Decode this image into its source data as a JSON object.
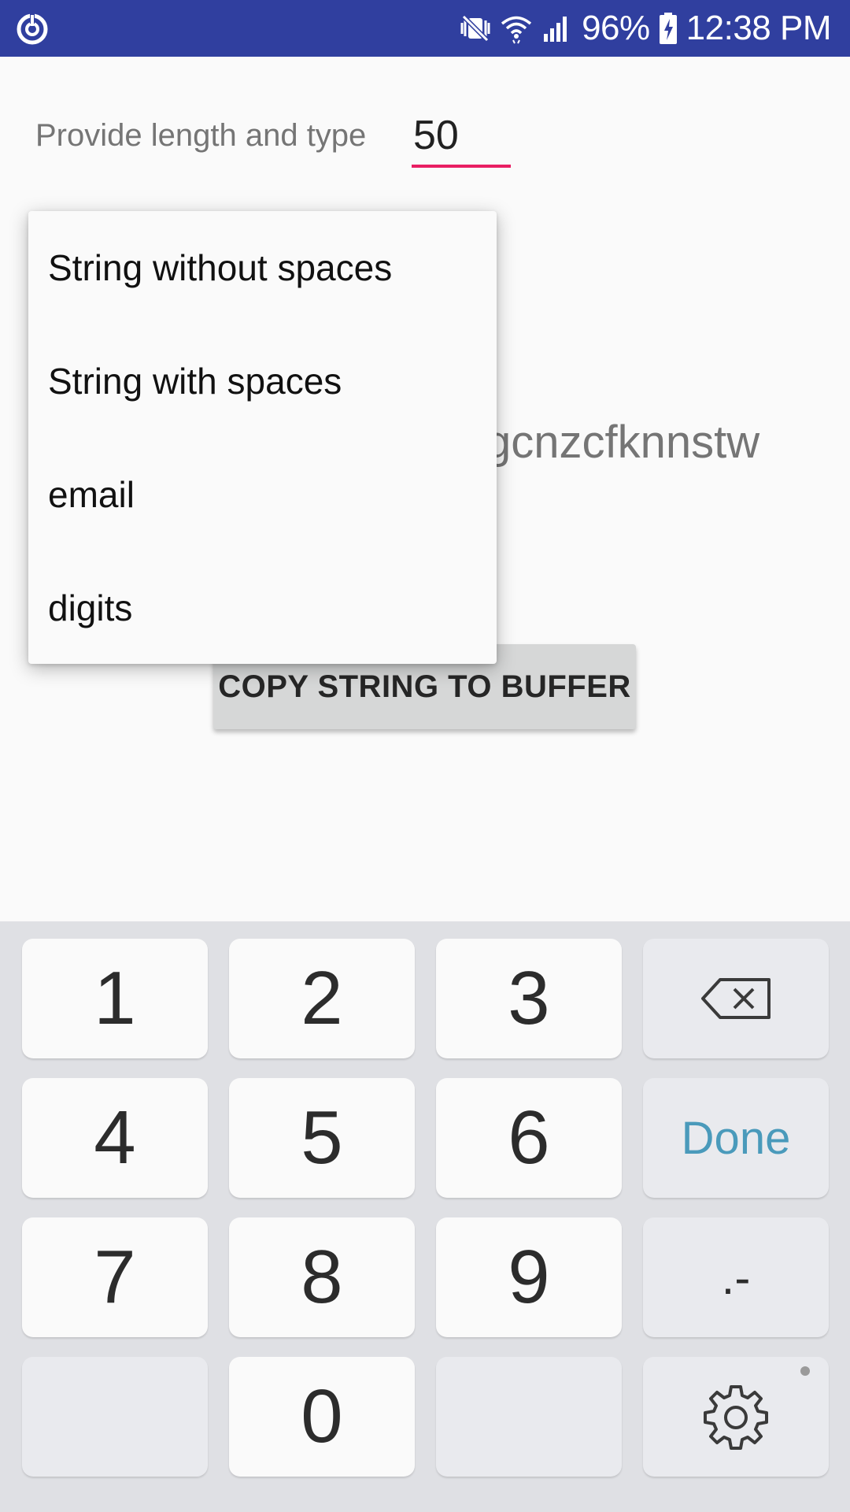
{
  "status_bar": {
    "app_icon": "sync-power-icon",
    "mute_icon": "vibrate-mute-icon",
    "wifi_icon": "wifi-icon",
    "signal_icon": "cell-signal-icon",
    "battery_percent": "96%",
    "battery_icon": "battery-charging-icon",
    "time": "12:38 PM",
    "background_color": "#303f9f"
  },
  "form": {
    "label": "Provide length and type",
    "length_value": "50",
    "accent_color": "#e91e63"
  },
  "output": {
    "visible_string_fragment": "gcnzcfknnstw"
  },
  "copy_button": {
    "label": "COPY STRING TO BUFFER"
  },
  "type_dropdown": {
    "options": [
      "String without spaces",
      "String with spaces",
      "email",
      "digits"
    ]
  },
  "keyboard": {
    "rows": [
      [
        "1",
        "2",
        "3",
        "backspace-icon"
      ],
      [
        "4",
        "5",
        "6",
        "Done"
      ],
      [
        "7",
        "8",
        "9",
        ".-"
      ],
      [
        "",
        "0",
        "",
        "settings-gear-icon"
      ]
    ],
    "done_label": "Done",
    "punct_label": ".-",
    "done_color": "#4a9abb"
  }
}
